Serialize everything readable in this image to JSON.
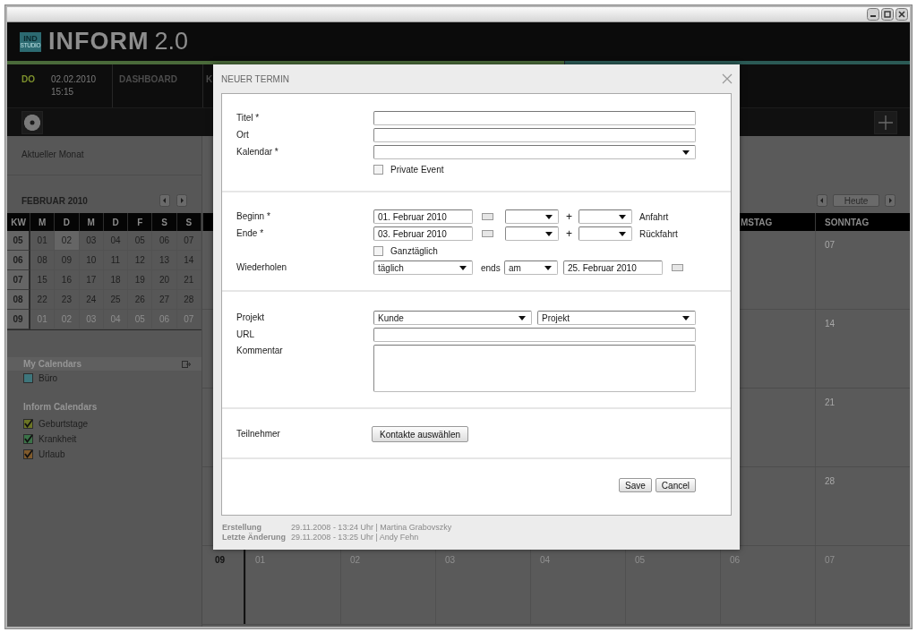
{
  "app": {
    "logo_mark": [
      "IND",
      "STUDIO"
    ],
    "title": "INFORM",
    "version": "2.0"
  },
  "nav": {
    "weekday": "DO",
    "date": "02.02.2010",
    "time": "15:15",
    "items": [
      "DASHBOARD",
      "K"
    ]
  },
  "sidebar": {
    "heading": "Aktueller Monat",
    "month": "FEBRUAR 2010",
    "week_header": "KW",
    "weekday_headers": [
      "M",
      "D",
      "M",
      "D",
      "F",
      "S",
      "S"
    ],
    "weeks": [
      {
        "kw": "05",
        "outside_month": false,
        "days": [
          {
            "label": "01",
            "selected": false
          },
          {
            "label": "02",
            "selected": true
          },
          {
            "label": "03",
            "selected": false
          },
          {
            "label": "04",
            "selected": false
          },
          {
            "label": "05",
            "selected": false
          },
          {
            "label": "06",
            "selected": false
          },
          {
            "label": "07",
            "selected": false
          }
        ]
      },
      {
        "kw": "06",
        "outside_month": false,
        "days": [
          {
            "label": "08",
            "selected": false
          },
          {
            "label": "09",
            "selected": false
          },
          {
            "label": "10",
            "selected": false
          },
          {
            "label": "11",
            "selected": false
          },
          {
            "label": "12",
            "selected": false
          },
          {
            "label": "13",
            "selected": false
          },
          {
            "label": "14",
            "selected": false
          }
        ]
      },
      {
        "kw": "07",
        "outside_month": false,
        "days": [
          {
            "label": "15",
            "selected": false
          },
          {
            "label": "16",
            "selected": false
          },
          {
            "label": "17",
            "selected": false
          },
          {
            "label": "18",
            "selected": false
          },
          {
            "label": "19",
            "selected": false
          },
          {
            "label": "20",
            "selected": false
          },
          {
            "label": "21",
            "selected": false
          }
        ]
      },
      {
        "kw": "08",
        "outside_month": false,
        "days": [
          {
            "label": "22",
            "selected": false
          },
          {
            "label": "23",
            "selected": false
          },
          {
            "label": "24",
            "selected": false
          },
          {
            "label": "25",
            "selected": false
          },
          {
            "label": "26",
            "selected": false
          },
          {
            "label": "27",
            "selected": false
          },
          {
            "label": "28",
            "selected": false
          }
        ]
      },
      {
        "kw": "09",
        "outside_month": true,
        "days": [
          {
            "label": "01",
            "selected": false
          },
          {
            "label": "02",
            "selected": false
          },
          {
            "label": "03",
            "selected": false
          },
          {
            "label": "04",
            "selected": false
          },
          {
            "label": "05",
            "selected": false
          },
          {
            "label": "06",
            "selected": false
          },
          {
            "label": "07",
            "selected": false
          }
        ]
      }
    ],
    "my_calendars": {
      "title": "My Calendars",
      "items": [
        {
          "label": "Büro",
          "color": "#3e767c",
          "checked": false
        }
      ]
    },
    "inform_calendars": {
      "title": "Inform Calendars",
      "items": [
        {
          "label": "Geburtstage",
          "color": "#6b7424",
          "checked": true
        },
        {
          "label": "Krankheit",
          "color": "#3b7248",
          "checked": true
        },
        {
          "label": "Urlaub",
          "color": "#7f5a2c",
          "checked": true
        }
      ]
    }
  },
  "month_view": {
    "today_button": "Heute",
    "day_headers": [
      "MSTAG",
      "SONNTAG"
    ],
    "weeks": [
      {
        "sunday": "07"
      },
      {
        "sunday": "14"
      },
      {
        "sunday": "21"
      },
      {
        "sunday": "28"
      },
      {
        "kw": "09",
        "outside_month": true,
        "days": [
          "01",
          "02",
          "03",
          "04",
          "05",
          "06",
          "07"
        ]
      }
    ]
  },
  "dialog": {
    "title": "NEUER TERMIN",
    "sections": [
      {
        "rows": [
          {
            "kind": "text",
            "label": "Titel *"
          },
          {
            "kind": "text",
            "label": "Ort"
          },
          {
            "kind": "select",
            "label": "Kalendar *"
          },
          {
            "kind": "checkbox",
            "text": "Private Event",
            "checked": false
          }
        ]
      },
      {
        "rows": [
          {
            "kind": "datetime",
            "label": "Beginn *",
            "date": "01. Februar 2010",
            "plus": "+",
            "travel": "Anfahrt"
          },
          {
            "kind": "datetime",
            "label": "Ende *",
            "date": "03. Februar 2010",
            "plus": "+",
            "travel": "Rückfahrt"
          },
          {
            "kind": "checkbox",
            "text": "Ganztäglich",
            "checked": false
          },
          {
            "kind": "repeat",
            "label": "Wiederholen",
            "frequency": "täglich",
            "ends_label": "ends",
            "ends_mode": "am",
            "end_date": "25. Februar 2010"
          }
        ]
      },
      {
        "rows": [
          {
            "kind": "selects",
            "label": "Projekt",
            "options": [
              "Kunde",
              "Projekt"
            ]
          },
          {
            "kind": "text",
            "label": "URL"
          },
          {
            "kind": "textarea",
            "label": "Kommentar"
          }
        ]
      },
      {
        "rows": [
          {
            "kind": "button",
            "label": "Teilnehmer",
            "button": "Kontakte auswählen"
          }
        ]
      }
    ],
    "actions": [
      "Save",
      "Cancel"
    ],
    "meta": [
      {
        "label": "Erstellung",
        "value": "29.11.2008 - 13:24 Uhr | Martina Grabovszky"
      },
      {
        "label": "Letzte Änderung",
        "value": "29.11.2008 - 13:25 Uhr | Andy Fehn"
      }
    ]
  }
}
